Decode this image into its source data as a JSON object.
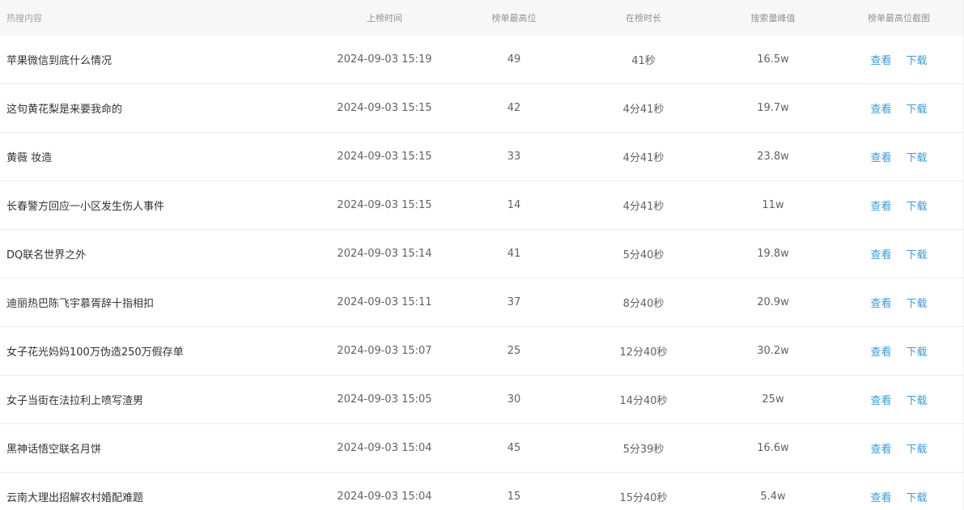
{
  "headers": {
    "content": "热搜内容",
    "time": "上榜时间",
    "top_rank": "榜单最高位",
    "duration": "在榜时长",
    "peak": "搜索量峰值",
    "screenshot": "榜单最高位截图"
  },
  "actions": {
    "view": "查看",
    "download": "下载"
  },
  "colors": {
    "link": "#3a9bd5",
    "header_bg": "#f7f7f7",
    "divider": "#ececec"
  },
  "rows": [
    {
      "content": "苹果微信到底什么情况",
      "time": "2024-09-03 15:19",
      "rank": "49",
      "duration": "41秒",
      "peak": "16.5w"
    },
    {
      "content": "这句黄花梨是来要我命的",
      "time": "2024-09-03 15:15",
      "rank": "42",
      "duration": "4分41秒",
      "peak": "19.7w"
    },
    {
      "content": "黄薇 妆造",
      "time": "2024-09-03 15:15",
      "rank": "33",
      "duration": "4分41秒",
      "peak": "23.8w"
    },
    {
      "content": "长春警方回应一小区发生伤人事件",
      "time": "2024-09-03 15:15",
      "rank": "14",
      "duration": "4分41秒",
      "peak": "11w"
    },
    {
      "content": "DQ联名世界之外",
      "time": "2024-09-03 15:14",
      "rank": "41",
      "duration": "5分40秒",
      "peak": "19.8w"
    },
    {
      "content": "迪丽热巴陈飞宇慕胥辞十指相扣",
      "time": "2024-09-03 15:11",
      "rank": "37",
      "duration": "8分40秒",
      "peak": "20.9w"
    },
    {
      "content": "女子花光妈妈100万伪造250万假存单",
      "time": "2024-09-03 15:07",
      "rank": "25",
      "duration": "12分40秒",
      "peak": "30.2w"
    },
    {
      "content": "女子当街在法拉利上喷写渣男",
      "time": "2024-09-03 15:05",
      "rank": "30",
      "duration": "14分40秒",
      "peak": "25w"
    },
    {
      "content": "黑神话悟空联名月饼",
      "time": "2024-09-03 15:04",
      "rank": "45",
      "duration": "5分39秒",
      "peak": "16.6w"
    },
    {
      "content": "云南大理出招解农村婚配难题",
      "time": "2024-09-03 15:04",
      "rank": "15",
      "duration": "15分40秒",
      "peak": "5.4w"
    }
  ]
}
